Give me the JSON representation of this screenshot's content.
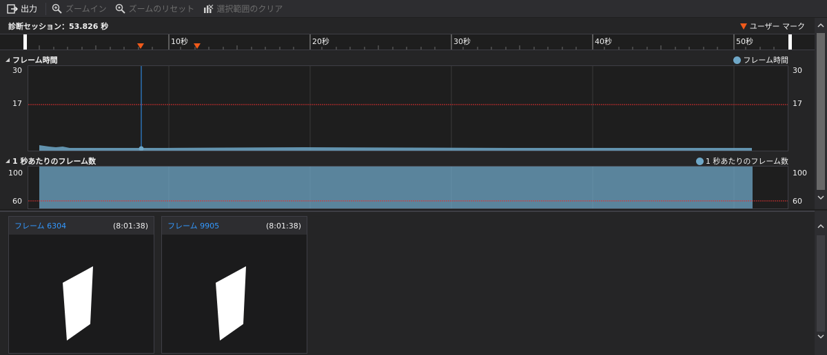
{
  "toolbar": {
    "output_label": "出力",
    "zoom_in_label": "ズームイン",
    "zoom_reset_label": "ズームのリセット",
    "clear_selection_label": "選択範囲のクリア"
  },
  "session": {
    "label": "診断セッション：53.826 秒",
    "user_mark_label": "ユーザー マーク"
  },
  "ruler": {
    "ticks": [
      "10秒",
      "20秒",
      "30秒",
      "40秒",
      "50秒"
    ]
  },
  "frame_time_chart": {
    "title": "フレーム時間",
    "legend": "フレーム時間",
    "y_top_left": "30",
    "y_mid_left": "17",
    "y_top_right": "30",
    "y_mid_right": "17"
  },
  "fps_chart": {
    "title": "1 秒あたりのフレーム数",
    "legend": "1 秒あたりのフレーム数",
    "y_top_left": "100",
    "y_mid_left": "60",
    "y_top_right": "100",
    "y_mid_right": "60"
  },
  "frames": [
    {
      "name": "フレーム 6304",
      "time": "(8:01:38)"
    },
    {
      "name": "フレーム 9905",
      "time": "(8:01:38)"
    }
  ],
  "colors": {
    "series": "#6fa7c7",
    "threshold": "#e03030",
    "marker": "#f05a1a",
    "link": "#3399ff"
  }
}
